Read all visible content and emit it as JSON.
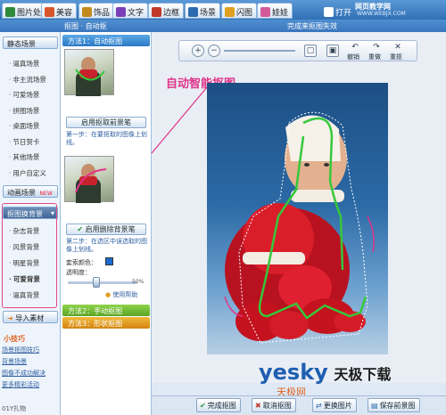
{
  "top_tabs": [
    {
      "label": "图片处理",
      "icon": "image-icon",
      "color": "#2f8a3a"
    },
    {
      "label": "美容",
      "icon": "face-icon",
      "color": "#d8552a"
    },
    {
      "label": "饰品",
      "icon": "ornament-icon",
      "color": "#c28a1e"
    },
    {
      "label": "文字",
      "icon": "text-icon",
      "color": "#7a3fb8"
    },
    {
      "label": "边框",
      "icon": "frame-icon",
      "color": "#c0392b"
    },
    {
      "label": "场景",
      "icon": "scene-icon",
      "color": "#2b6cb0"
    },
    {
      "label": "闪图",
      "icon": "flash-icon",
      "color": "#e0a020"
    },
    {
      "label": "娃娃",
      "icon": "doll-icon",
      "color": "#d45a9a"
    },
    {
      "label": "打开",
      "icon": "open-icon",
      "color": "#ffffff"
    }
  ],
  "site_watermark_top": "网页教学网",
  "site_url_top": "WWW.WEBJX.COM",
  "titlebar": {
    "left": "抠图 · 自动抠",
    "right": "完成来抠图失效"
  },
  "sidebar": {
    "static_scene_label": "静态场景",
    "static_items": [
      "逼真场景",
      "非主流场景",
      "可爱场景",
      "拼图场景",
      "桌面场景",
      "节日贺卡",
      "其他场景",
      "用户自定义"
    ],
    "animated_scene_label": "动画场景",
    "cutout_label": "抠图换背景",
    "cutout_items": [
      "杂志背景",
      "风景背景",
      "明星背景",
      "可爱背景",
      "逼真背景"
    ],
    "import_label": "导入素材",
    "tips_title": "小技巧",
    "tips_items": [
      "场景抠图技巧",
      "背景场景",
      "图像不成功解决",
      "更多精彩活动"
    ],
    "status": "01Y扎物"
  },
  "panel": {
    "method1_header": "方法1：自动抠图",
    "method1_button": "启用抠取前景笔",
    "method1_step": "第一步：在要抠取的图像上划线。",
    "method1b_button": "启用删除背景笔",
    "method1b_step": "第二步：在选区中误选取的图像上划线。",
    "edge_color_label": "套索颜色：",
    "opacity_label": "透明度：",
    "opacity_value": "50%",
    "help_link": "使用帮助",
    "method2_header": "方法2：手动抠图",
    "method3_header": "方法3：形状抠图"
  },
  "toolbar": {
    "zoom_in": "放大",
    "zoom_out": "缩小",
    "fit": "适合",
    "actual": "原大",
    "undo_label": "撤销",
    "redo_label": "重做",
    "reset_label": "重抠"
  },
  "callout": "自动智能抠图",
  "bottom_buttons": [
    {
      "label": "完成抠图",
      "icon": "check-icon"
    },
    {
      "label": "取消抠图",
      "icon": "close-icon"
    },
    {
      "label": "更换图片",
      "icon": "swap-icon"
    },
    {
      "label": "保存前景图",
      "icon": "save-icon"
    }
  ],
  "watermark": {
    "logo": "yesky",
    "brand": "天极下载",
    "sub": "天极网"
  },
  "colors": {
    "accent_pink": "#e0348a",
    "green_stroke": "#35c83a",
    "tab_blue": "#2f6fb5"
  }
}
